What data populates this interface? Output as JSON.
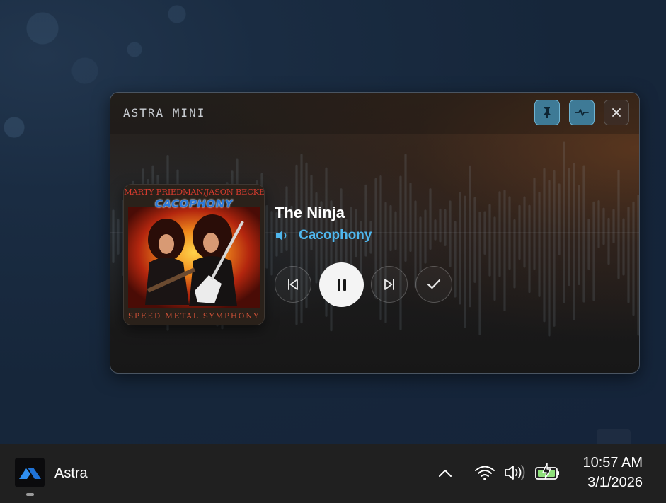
{
  "window": {
    "title": "ASTRA MINI",
    "buttons": {
      "pin": "pin-icon",
      "pulse": "pulse-icon",
      "close": "close-icon"
    }
  },
  "album": {
    "cover_artist_line": "MARTY FRIEDMAN/JASON BECKER",
    "cover_logo": "CACOPHONY",
    "cover_subtitle": "SPEED METAL SYMPHONY"
  },
  "track": {
    "title": "The Ninja",
    "artist": "Cacophony",
    "playing_icon": "speaker-icon"
  },
  "controls": {
    "previous": "skip-previous-icon",
    "pause": "pause-icon",
    "next": "skip-next-icon",
    "confirm": "checkmark-icon"
  },
  "taskbar": {
    "app_label": "Astra",
    "time": "10:57 AM",
    "date": "3/1/2026",
    "tray_icons": [
      "chevron-up-icon",
      "wifi-icon",
      "volume-icon",
      "battery-charging-icon"
    ]
  },
  "colors": {
    "accent_blue": "#4fb7ee",
    "header_button_blue": "#3e7a96",
    "battery_green": "#8ee07a"
  }
}
